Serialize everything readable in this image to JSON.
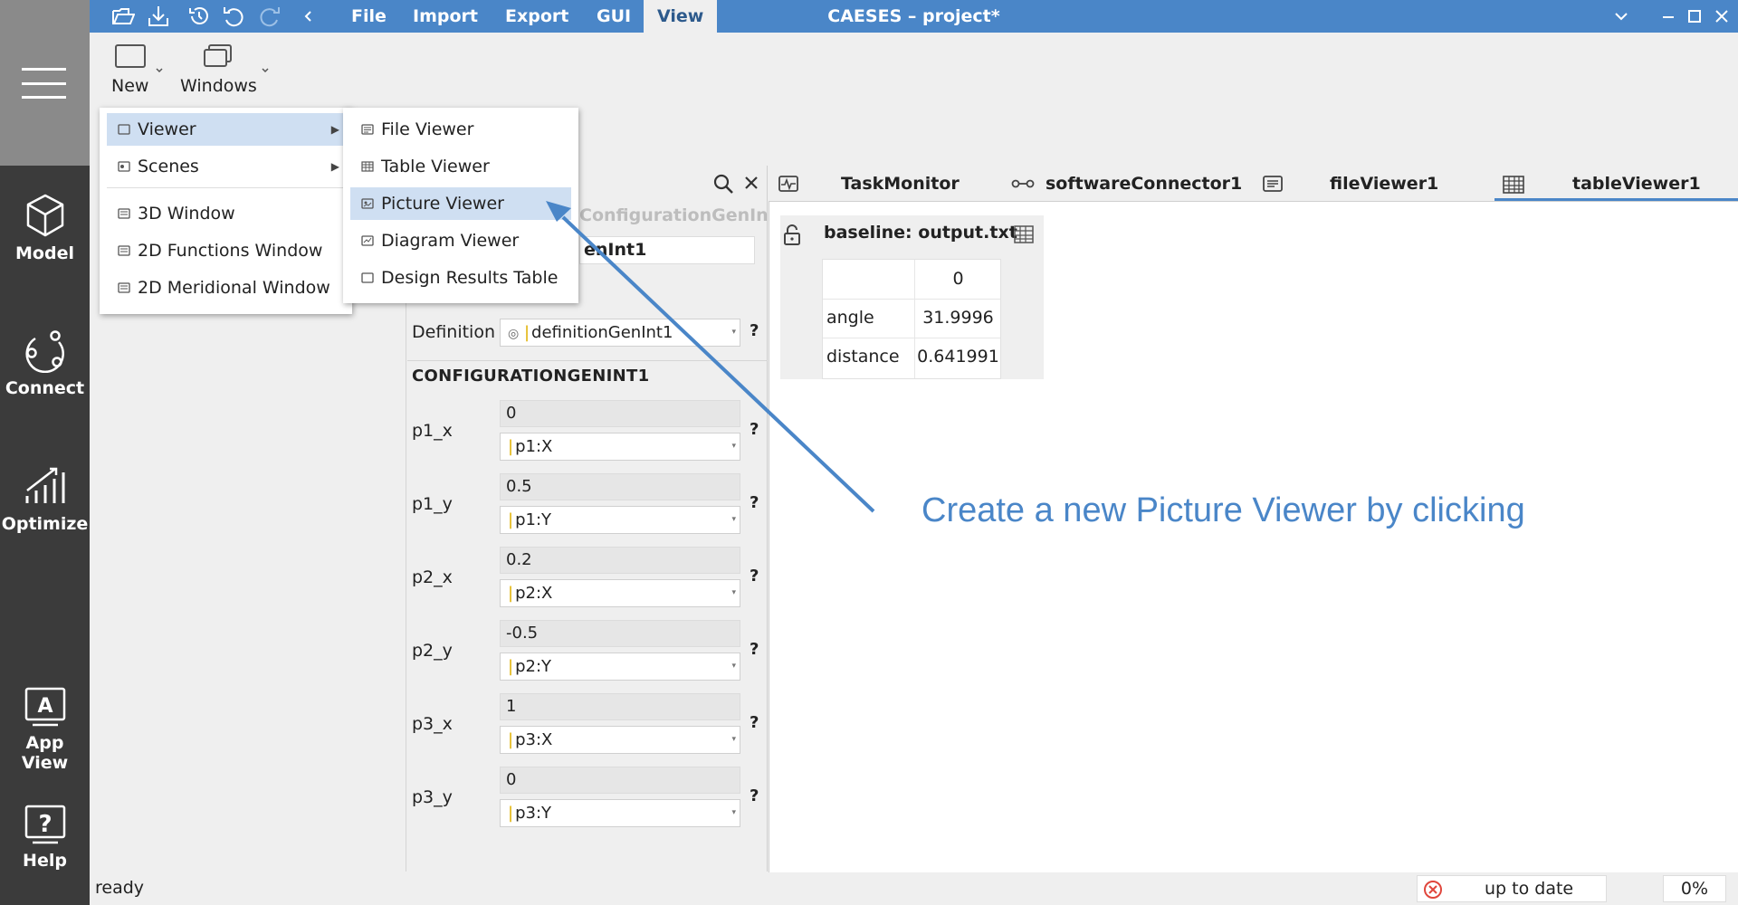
{
  "titlebar": {
    "menus": [
      "File",
      "Import",
      "Export",
      "GUI",
      "View"
    ],
    "active_menu": "View",
    "app_title": "CAESES – project*"
  },
  "sidebar": {
    "items": [
      {
        "label": "Model",
        "icon": "cube-icon"
      },
      {
        "label": "Connect",
        "icon": "connect-icon"
      },
      {
        "label": "Optimize",
        "icon": "chart-icon"
      },
      {
        "label": "App View",
        "icon": "app-view-icon"
      },
      {
        "label": "Help",
        "icon": "help-icon"
      }
    ]
  },
  "ribbon": {
    "new_label": "New",
    "windows_label": "Windows"
  },
  "view_menu": {
    "items": [
      {
        "label": "Viewer",
        "has_submenu": true
      },
      {
        "label": "Scenes",
        "has_submenu": true
      },
      {
        "label": "3D Window"
      },
      {
        "label": "2D Functions Window"
      },
      {
        "label": "2D Meridional Window"
      }
    ],
    "highlighted": "Viewer"
  },
  "viewer_submenu": {
    "items": [
      {
        "label": "File Viewer"
      },
      {
        "label": "Table Viewer"
      },
      {
        "label": "Picture Viewer"
      },
      {
        "label": "Diagram Viewer"
      },
      {
        "label": "Design Results Table"
      }
    ],
    "highlighted": "Picture Viewer"
  },
  "properties": {
    "header_type": "ConfigurationGenInt",
    "name_value": "enInt1",
    "definition_label": "Definition",
    "definition_value": "definitionGenInt1",
    "section_title": "CONFIGURATIONGENINT1",
    "help_mark": "?",
    "params": [
      {
        "label": "p1_x",
        "value": "0",
        "ref": "p1:X"
      },
      {
        "label": "p1_y",
        "value": "0.5",
        "ref": "p1:Y"
      },
      {
        "label": "p2_x",
        "value": "0.2",
        "ref": "p2:X"
      },
      {
        "label": "p2_y",
        "value": "-0.5",
        "ref": "p2:Y"
      },
      {
        "label": "p3_x",
        "value": "1",
        "ref": "p3:X"
      },
      {
        "label": "p3_y",
        "value": "0",
        "ref": "p3:Y"
      }
    ]
  },
  "tabs": [
    {
      "label": "TaskMonitor",
      "icon": "task-monitor-icon"
    },
    {
      "label": "softwareConnector1",
      "icon": "connector-icon"
    },
    {
      "label": "fileViewer1",
      "icon": "file-viewer-icon"
    },
    {
      "label": "tableViewer1",
      "icon": "table-viewer-icon",
      "active": true
    }
  ],
  "table_viewer": {
    "title": "baseline: output.txt",
    "column_header": "0",
    "rows": [
      {
        "name": "angle",
        "value": "31.9996"
      },
      {
        "name": "distance",
        "value": "0.641991"
      }
    ]
  },
  "annotation": "Create a new Picture Viewer by clicking",
  "statusbar": {
    "status": "ready",
    "sync_status": "up to date",
    "progress": "0%"
  },
  "colors": {
    "accent": "#4a86c8",
    "sidebar": "#3b3b3b",
    "menu_highlight": "#cfdff2",
    "error_icon": "#e0463c"
  }
}
